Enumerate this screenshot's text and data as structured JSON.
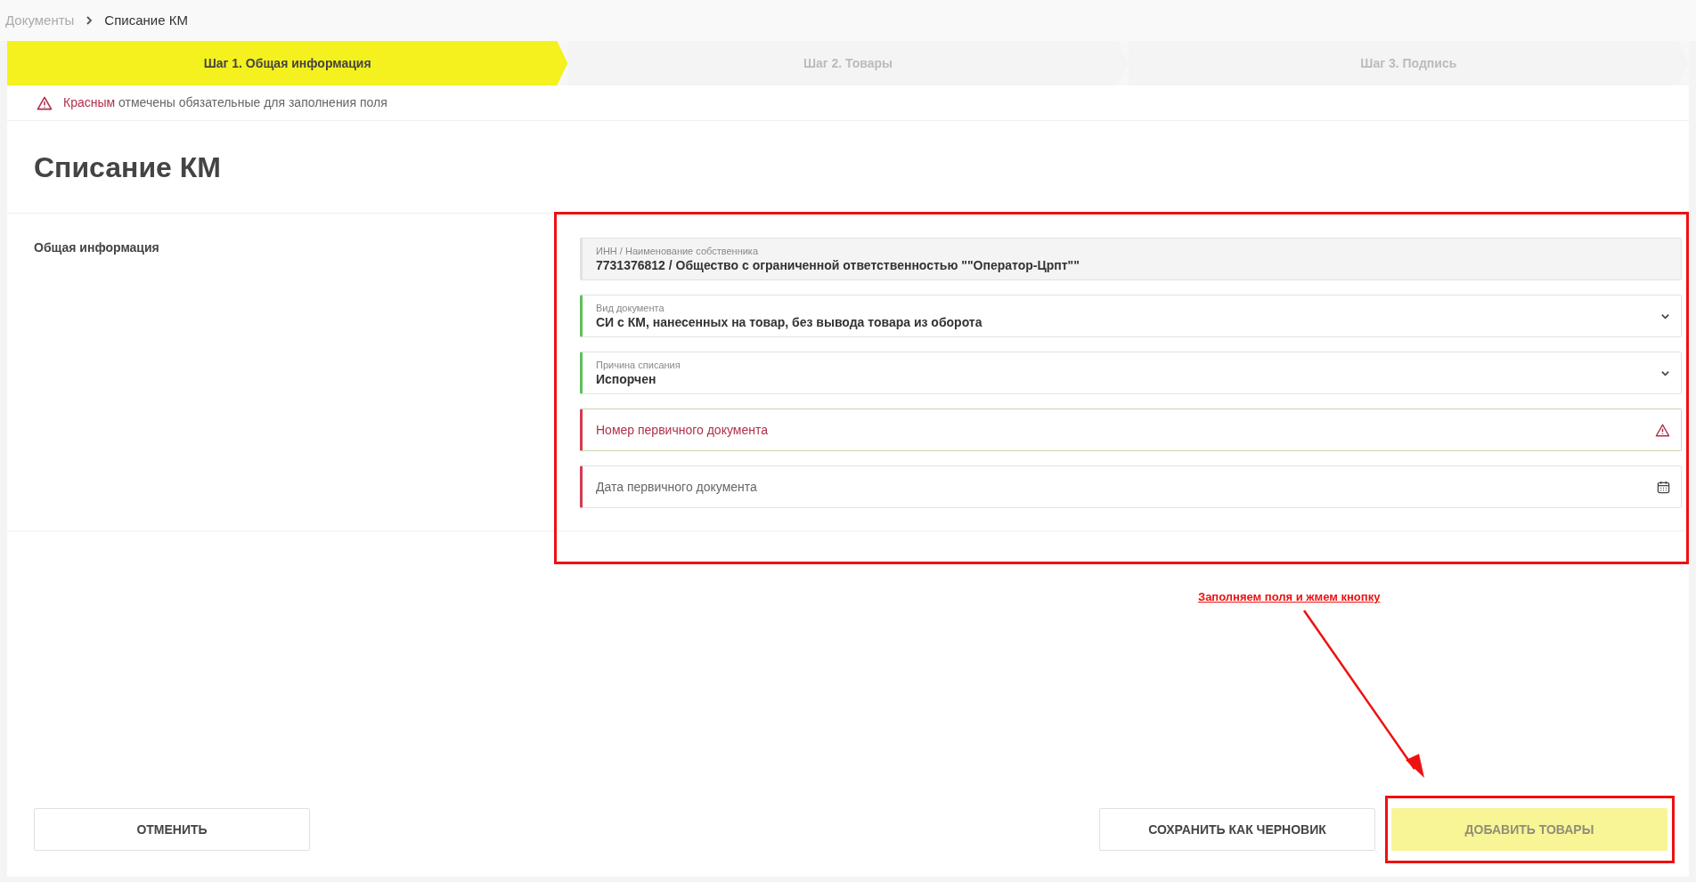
{
  "breadcrumbs": [
    {
      "label": "Документы",
      "current": false
    },
    {
      "label": "Списание КМ",
      "current": true
    }
  ],
  "steps": [
    {
      "label": "Шаг 1. Общая информация",
      "selected": true
    },
    {
      "label": "Шаг 2. Товары",
      "selected": false
    },
    {
      "label": "Шаг 3. Подпись",
      "selected": false
    }
  ],
  "hint": {
    "highlight": "Красным",
    "text": "отмечены обязательные для заполнения поля"
  },
  "title": "Списание КМ",
  "section_label": "Общая информация",
  "fields": [
    {
      "kind": "readonly",
      "valid": false,
      "error": false,
      "label": "ИНН / Наименование собственника",
      "value": "7731376812 / Общество с ограниченной ответственностью \"\"Оператор-Црпт\"\""
    },
    {
      "kind": "select",
      "valid": true,
      "error": false,
      "label": "Вид документа",
      "value": "СИ с КМ, нанесенных на товар, без вывода товара из оборота"
    },
    {
      "kind": "select",
      "valid": true,
      "error": false,
      "label": "Причина списания",
      "value": "Испорчен"
    },
    {
      "kind": "text",
      "valid": false,
      "error": true,
      "placeholder": "Номер первичного документа"
    },
    {
      "kind": "date",
      "valid": false,
      "error": true,
      "placeholder": "Дата первичного документа"
    }
  ],
  "buttons": [
    {
      "label": "ОТМЕНИТЬ",
      "kind": "secondary",
      "disabled": false
    },
    {
      "label": "СОХРАНИТЬ КАК ЧЕРНОВИК",
      "kind": "secondary",
      "disabled": false
    },
    {
      "label": "ДОБАВИТЬ ТОВАРЫ",
      "kind": "primary",
      "disabled": true
    }
  ],
  "annotation": {
    "text": "Заполняем поля и жмем кнопку"
  }
}
